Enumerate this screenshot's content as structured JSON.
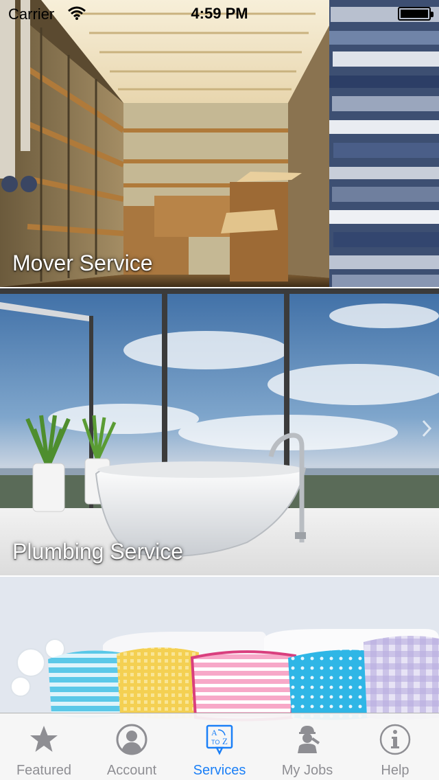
{
  "status_bar": {
    "carrier": "Carrier",
    "time": "4:59 PM",
    "wifi_icon": "wifi-icon",
    "battery_icon": "battery-icon"
  },
  "services": [
    {
      "label": "Mover Service",
      "image": "moving-truck-interior"
    },
    {
      "label": "Plumbing Service",
      "image": "bathtub-with-view"
    },
    {
      "label": "",
      "image": "colorful-pillows-on-sofa"
    }
  ],
  "tab_bar": {
    "active": "Services",
    "accent_color": "#1a7ff7",
    "inactive_color": "#8e8e93",
    "tabs": [
      {
        "label": "Featured",
        "icon": "star-icon"
      },
      {
        "label": "Account",
        "icon": "person-icon"
      },
      {
        "label": "Services",
        "icon": "a-to-z-icon"
      },
      {
        "label": "My Jobs",
        "icon": "worker-icon"
      },
      {
        "label": "Help",
        "icon": "info-icon"
      }
    ]
  }
}
